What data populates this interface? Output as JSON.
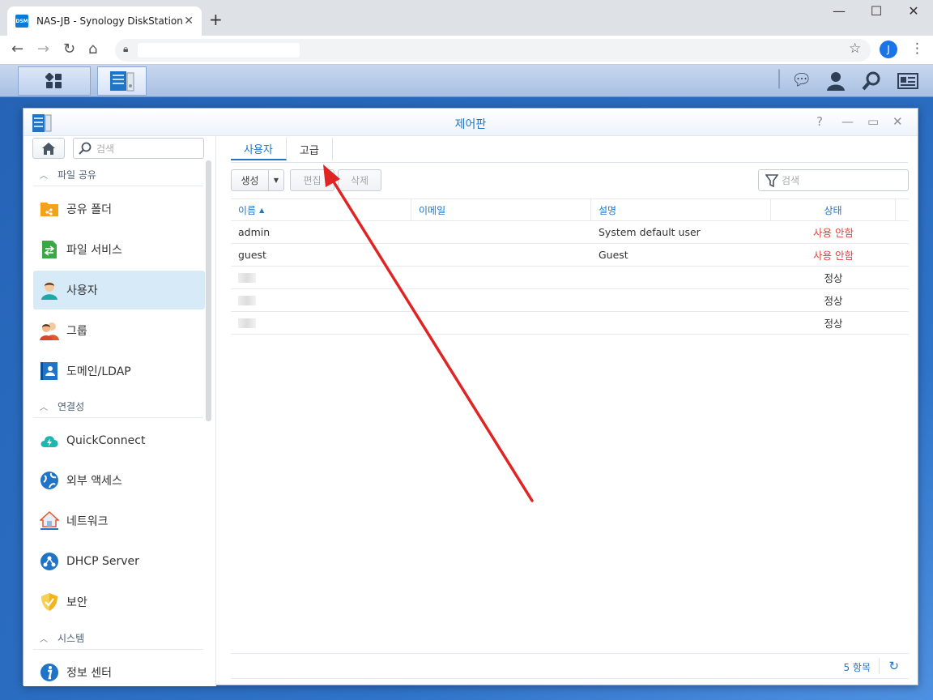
{
  "browser": {
    "tab_title": "NAS-JB - Synology DiskStation",
    "tab_favicon_text": "DSM",
    "profile_initial": "J",
    "icons": [
      "back-icon",
      "forward-icon",
      "reload-icon",
      "home-icon",
      "lock-icon",
      "star-icon",
      "kebab-menu-icon"
    ]
  },
  "window": {
    "title": "제어판",
    "controls": [
      "help-icon",
      "minimize-icon",
      "maximize-icon",
      "close-icon"
    ]
  },
  "sidebar": {
    "search_placeholder": "검색",
    "sections": [
      {
        "label": "파일 공유"
      },
      {
        "label": "연결성"
      },
      {
        "label": "시스템"
      }
    ],
    "items": [
      {
        "label": "공유 폴더",
        "icon": "shared-folder-icon"
      },
      {
        "label": "파일 서비스",
        "icon": "file-services-icon"
      },
      {
        "label": "사용자",
        "icon": "user-icon",
        "selected": true
      },
      {
        "label": "그룹",
        "icon": "group-icon"
      },
      {
        "label": "도메인/LDAP",
        "icon": "domain-ldap-icon"
      },
      {
        "label": "QuickConnect",
        "icon": "quickconnect-icon"
      },
      {
        "label": "외부 액세스",
        "icon": "external-access-icon"
      },
      {
        "label": "네트워크",
        "icon": "network-icon"
      },
      {
        "label": "DHCP Server",
        "icon": "dhcp-server-icon"
      },
      {
        "label": "보안",
        "icon": "security-icon"
      },
      {
        "label": "정보 센터",
        "icon": "info-center-icon"
      }
    ]
  },
  "main": {
    "tabs": [
      {
        "label": "사용자",
        "active": true
      },
      {
        "label": "고급",
        "active": false
      }
    ],
    "buttons": {
      "create": "생성",
      "edit": "편집",
      "delete": "삭제"
    },
    "search_placeholder": "검색",
    "columns": [
      "이름",
      "이메일",
      "설명",
      "상태"
    ],
    "rows": [
      {
        "name": "admin",
        "email": "",
        "description": "System default user",
        "status": "사용 안함",
        "disabled": true
      },
      {
        "name": "guest",
        "email": "",
        "description": "Guest",
        "status": "사용 안함",
        "disabled": true
      },
      {
        "name": "",
        "email": "",
        "description": "",
        "status": "정상",
        "disabled": false,
        "blurred": true
      },
      {
        "name": "",
        "email": "",
        "description": "",
        "status": "정상",
        "disabled": false,
        "blurred": true
      },
      {
        "name": "",
        "email": "",
        "description": "",
        "status": "정상",
        "disabled": false,
        "blurred": true
      }
    ],
    "item_count": "5 항목"
  },
  "colors": {
    "accent": "#1f74c8",
    "disabled_status": "#e0453c",
    "selected_bg": "#d7eaf8",
    "annotation_arrow": "#e02424"
  }
}
